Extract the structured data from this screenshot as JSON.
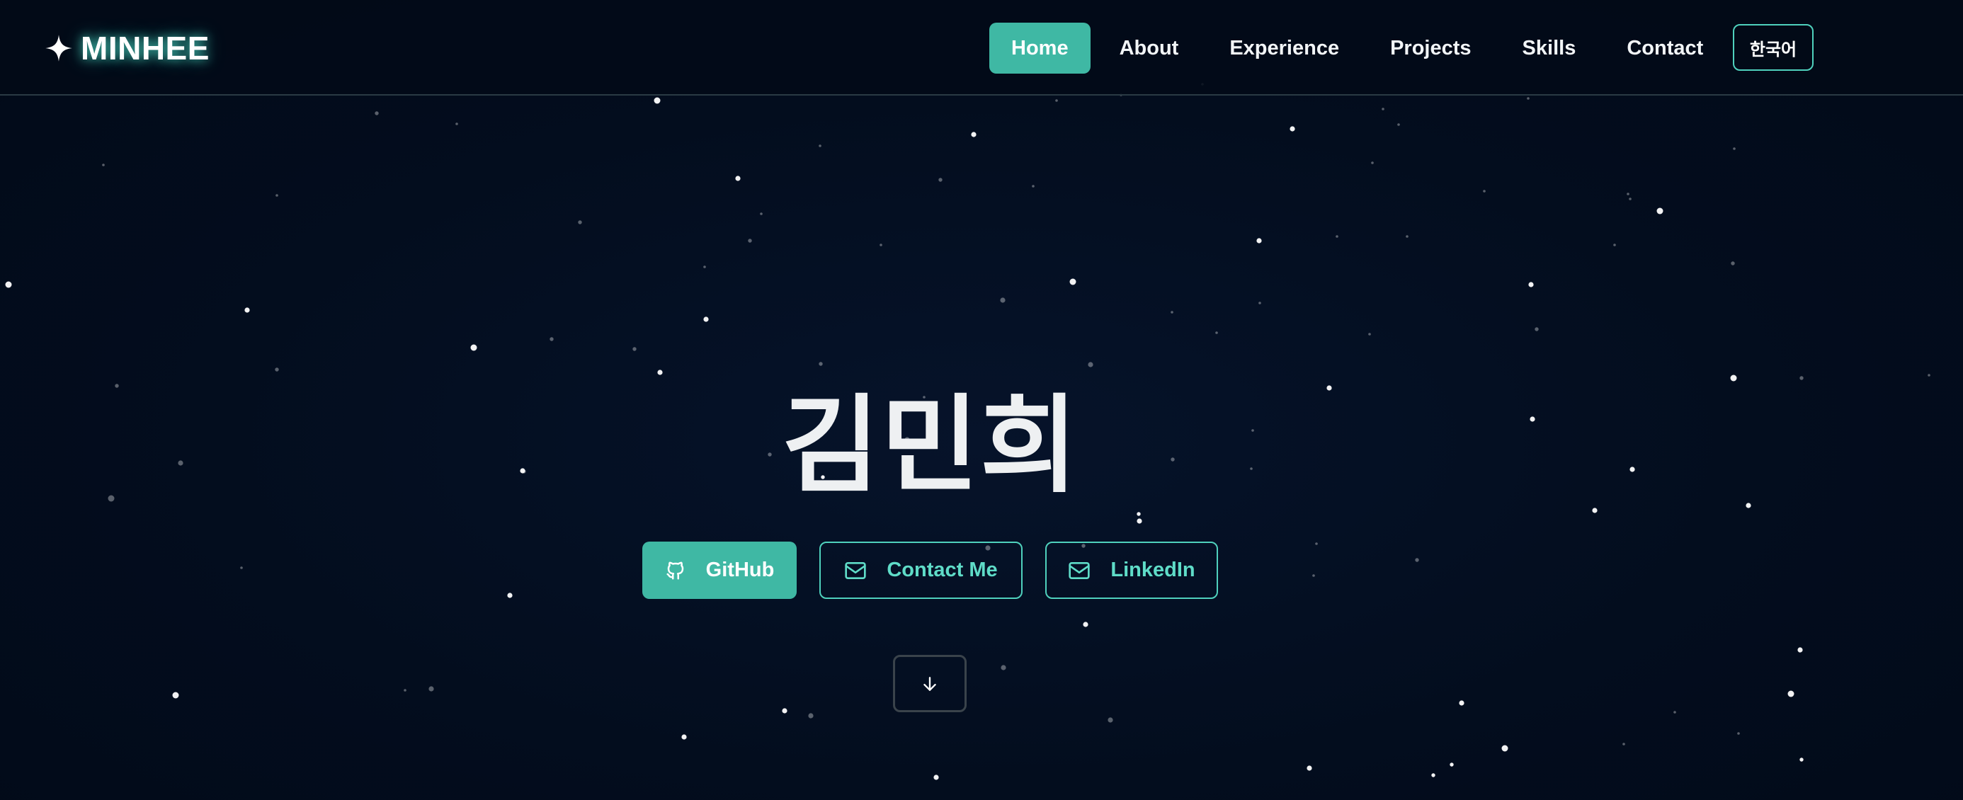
{
  "brand": {
    "logo_text": "MINHEE",
    "logo_icon": "sparkle-icon",
    "accent_color": "#3fb8a4",
    "outline_color": "#4fd1bd",
    "background_color": "#020b1a"
  },
  "nav": {
    "items": [
      {
        "label": "Home",
        "active": true
      },
      {
        "label": "About",
        "active": false
      },
      {
        "label": "Experience",
        "active": false
      },
      {
        "label": "Projects",
        "active": false
      },
      {
        "label": "Skills",
        "active": false
      },
      {
        "label": "Contact",
        "active": false
      }
    ],
    "language_button": "한국어"
  },
  "hero": {
    "name": "김민희",
    "buttons": {
      "github": {
        "label": "GitHub",
        "icon": "github-icon"
      },
      "contact": {
        "label": "Contact Me",
        "icon": "mail-icon"
      },
      "linkedin": {
        "label": "LinkedIn",
        "icon": "mail-icon"
      }
    },
    "scroll_icon": "arrow-down-icon"
  }
}
